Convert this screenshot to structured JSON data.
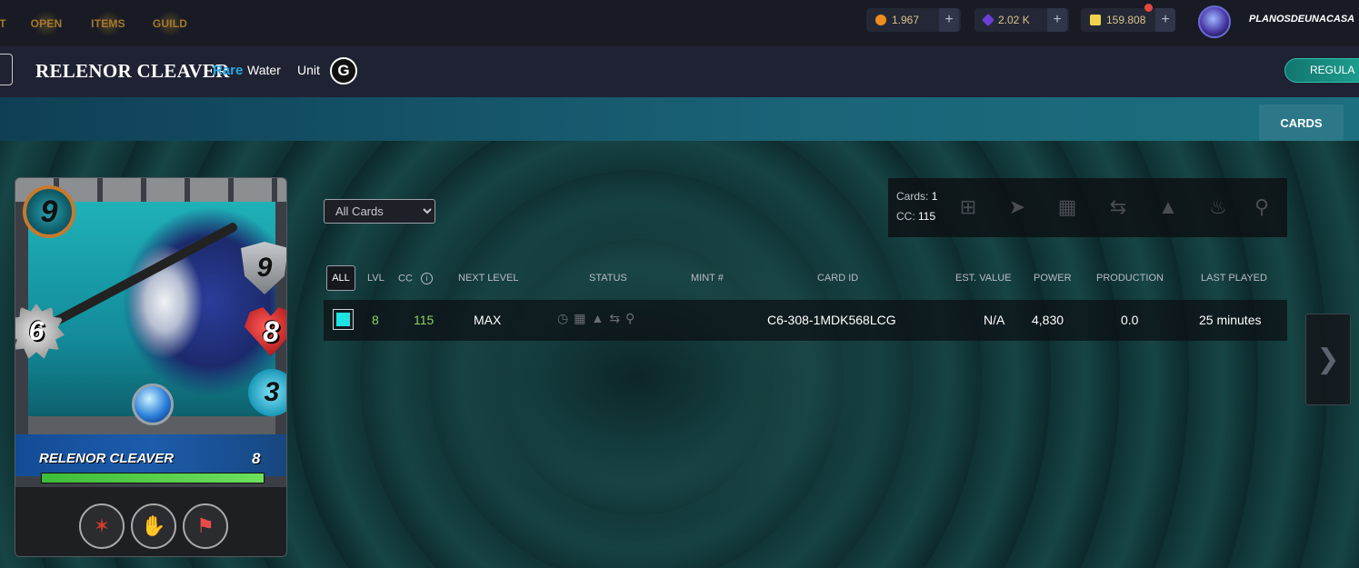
{
  "nav": {
    "items": [
      {
        "label": "T"
      },
      {
        "label": "OPEN"
      },
      {
        "label": "ITEMS"
      },
      {
        "label": "GUILD"
      }
    ],
    "currencies": [
      {
        "icon": "credits-coin-icon",
        "value": "1.967",
        "color": "#f08c1e"
      },
      {
        "icon": "dec-gem-icon",
        "value": "2.02 K",
        "color": "#6a3fd8"
      },
      {
        "icon": "sps-crystal-icon",
        "value": "159.808",
        "color": "#f2d24c"
      }
    ],
    "plus": "+",
    "username": "PLANOSDEUNACASA"
  },
  "card": {
    "title": "RELENOR CLEAVER",
    "rarity": "Rare",
    "element": "Water",
    "type": "Unit",
    "edition": "G",
    "name_on_card": "RELENOR CLEAVER",
    "level": "8",
    "xp_progress": 1.0,
    "mana": "9",
    "armor": "9",
    "health": "8",
    "speed": "3",
    "attack": "6",
    "abilities": [
      "blood-rage-icon",
      "cripple-claw-icon",
      "rally-flag-icon"
    ]
  },
  "header": {
    "regular_btn": "REGULA",
    "tab_cards": "CARDS"
  },
  "filter": {
    "selected": "All Cards"
  },
  "actions": {
    "cards_label": "Cards:",
    "cards_value": "1",
    "cc_label": "CC:",
    "cc_value": "115",
    "icons": [
      "combine-icon",
      "send-icon",
      "market-icon",
      "transfer-icon",
      "lock-icon",
      "burn-icon",
      "delegate-icon"
    ]
  },
  "table": {
    "headers": {
      "all": "ALL",
      "lvl": "LVL",
      "cc": "CC",
      "info": "i",
      "next_level": "NEXT LEVEL",
      "status": "STATUS",
      "mint": "MINT #",
      "card_id": "CARD ID",
      "est_value": "EST. VALUE",
      "power": "POWER",
      "production": "PRODUCTION",
      "last_played": "LAST PLAYED"
    },
    "row": {
      "lvl": "8",
      "cc": "115",
      "next_level": "MAX",
      "status_icons": [
        "clock-icon",
        "market-icon",
        "lock-icon",
        "transfer-icon",
        "delegate-icon"
      ],
      "mint": "",
      "card_id": "C6-308-1MDK568LCG",
      "est_value": "N/A",
      "power": "4,830",
      "production": "0.0",
      "last_played": "25 minutes"
    }
  }
}
